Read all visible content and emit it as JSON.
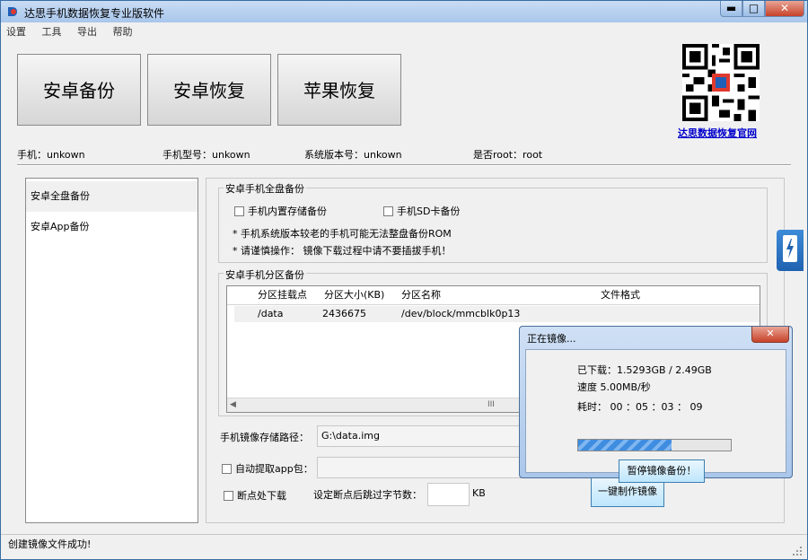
{
  "window": {
    "title": "达思手机数据恢复专业版软件",
    "min": "▬",
    "max": "□",
    "close": "✕"
  },
  "menu": [
    "设置",
    "工具",
    "导出",
    "帮助"
  ],
  "big_buttons": [
    "安卓备份",
    "安卓恢复",
    "苹果恢复"
  ],
  "qr_link": "达思数据恢复官网",
  "device_info": {
    "phone": "手机：unkown",
    "model": "手机型号：unkown",
    "system": "系统版本号：unkown",
    "root": "是否root：root"
  },
  "left_panel": [
    "安卓全盘备份",
    "安卓App备份"
  ],
  "full_backup": {
    "title": "安卓手机全盘备份",
    "internal": "手机内置存储备份",
    "sdcard": "手机SD卡备份",
    "note1": "* 手机系统版本较老的手机可能无法整盘备份ROM",
    "note2": "* 请谨慎操作： 镜像下载过程中请不要插拔手机！"
  },
  "partition": {
    "title": "安卓手机分区备份",
    "headers": [
      "分区挂载点",
      "分区大小(KB)",
      "分区名称",
      "文件格式"
    ],
    "rows": [
      {
        "mount": "/data",
        "size": "2436675",
        "name": "/dev/block/mmcblk0p13",
        "format": ""
      }
    ],
    "scroll_mark": "III"
  },
  "image_path": {
    "label": "手机镜像存储路径：",
    "value": "G:\\data.img"
  },
  "auto_extract": {
    "label": "自动提取app包："
  },
  "resume": {
    "label": "断点处下载"
  },
  "skip_bytes": {
    "label": "设定断点后跳过字节数：",
    "unit": "KB"
  },
  "make_image_button": "一键制作镜像",
  "status": "创建镜像文件成功!",
  "dialog": {
    "title": "正在镜像...",
    "close": "✕",
    "downloaded": "已下载：1.5293GB / 2.49GB",
    "speed": "速度 5.00MB/秒",
    "elapsed": "耗时：  00 ：05 ：03 ： 09",
    "progress": 0.61,
    "pause_button": "暂停镜像备份！"
  },
  "colors": {
    "accent": "#3c7fb1",
    "link": "#0000cc",
    "progress": "#3f8de0"
  }
}
